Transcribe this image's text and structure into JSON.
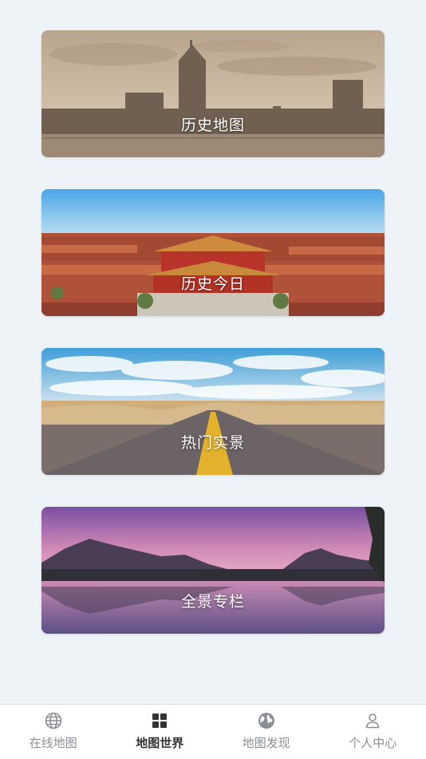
{
  "cards": [
    {
      "label": "历史地图",
      "image": "vintage-city-skyline"
    },
    {
      "label": "历史今日",
      "image": "forbidden-city-palace"
    },
    {
      "label": "热门实景",
      "image": "desert-road-sky"
    },
    {
      "label": "全景专栏",
      "image": "karst-lake-sunset"
    }
  ],
  "tabbar": {
    "tabs": [
      {
        "label": "在线地图",
        "icon": "globe-icon",
        "active": false
      },
      {
        "label": "地图世界",
        "icon": "grid-icon",
        "active": true
      },
      {
        "label": "地图发现",
        "icon": "earth-icon",
        "active": false
      },
      {
        "label": "个人中心",
        "icon": "user-icon",
        "active": false
      }
    ]
  },
  "colors": {
    "background": "#eef3f8",
    "tab_active": "#333333",
    "tab_inactive": "#8a8f96"
  }
}
